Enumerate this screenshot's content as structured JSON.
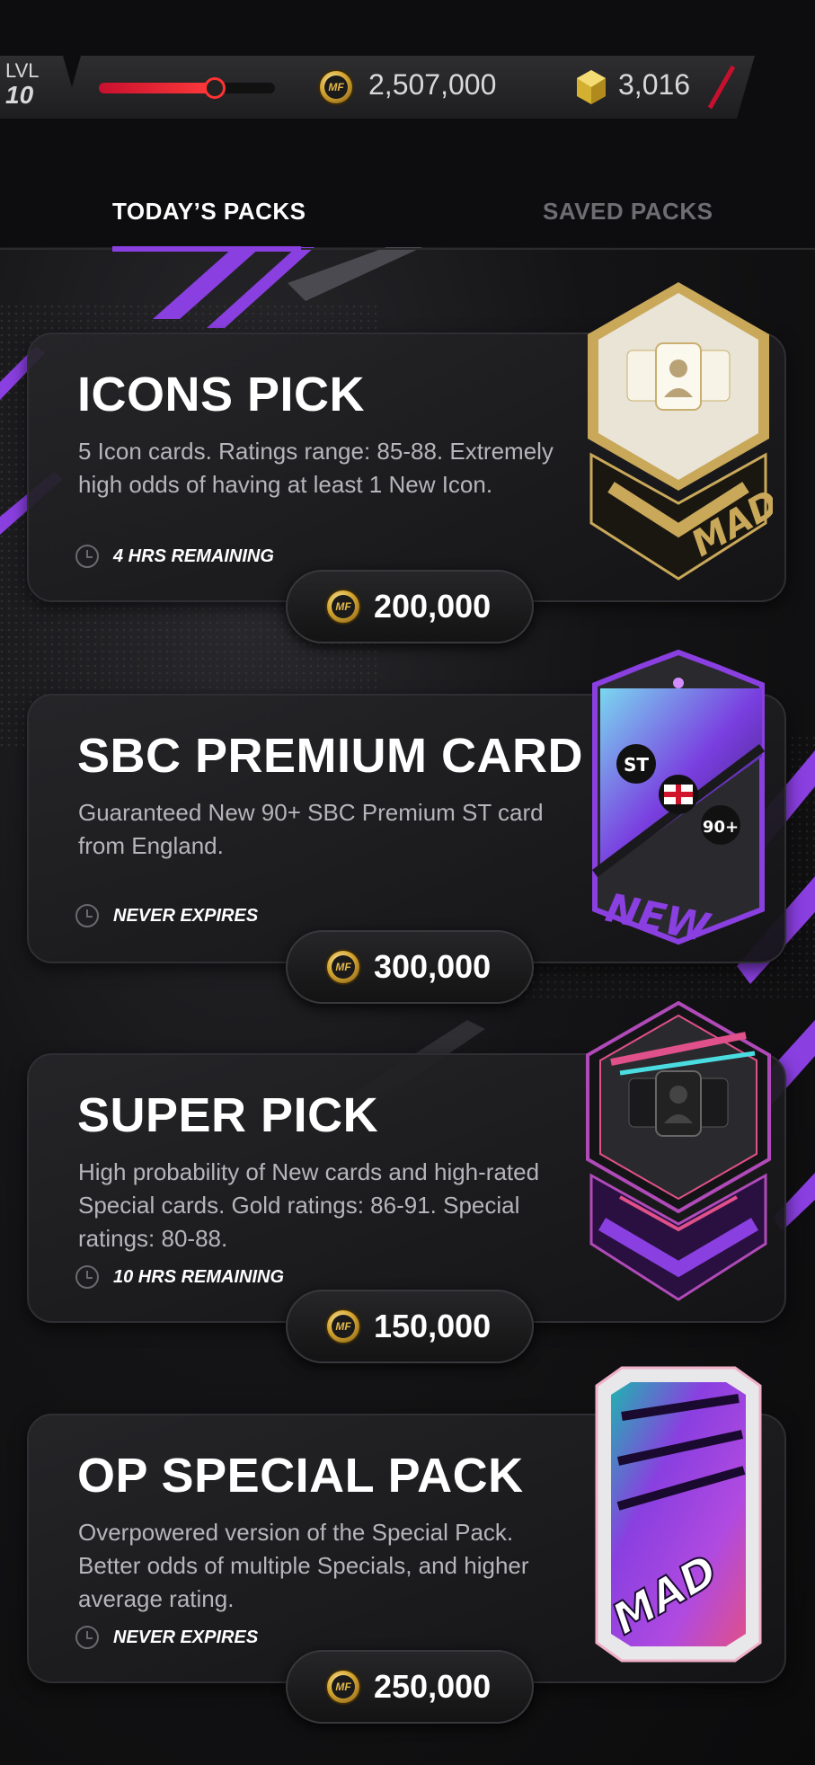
{
  "hud": {
    "level_label": "LVL",
    "level_value": "10",
    "xp_progress": 0.66,
    "coins": "2,507,000",
    "gems": "3,016",
    "coin_icon_text": "MF"
  },
  "tabs": [
    {
      "label": "TODAY’S PACKS",
      "active": true
    },
    {
      "label": "SAVED PACKS",
      "active": false
    }
  ],
  "packs": [
    {
      "title": "ICONS PICK",
      "description": "5 Icon cards. Ratings range: 85-88. Extremely high odds of having at least 1 New Icon.",
      "timer": "4 HRS REMAINING",
      "price": "200,000",
      "art": "icons-pick-pack-icon"
    },
    {
      "title": "SBC PREMIUM CARD",
      "description": "Guaranteed New 90+ SBC Premium ST card from England.",
      "timer": "NEVER EXPIRES",
      "price": "300,000",
      "art": "sbc-premium-card-icon",
      "badge_position": "ST",
      "badge_rating": "90+",
      "badge_new": "NEW"
    },
    {
      "title": "SUPER PICK",
      "description": "High probability of New cards and high-rated Special cards. Gold ratings: 86-91. Special ratings: 80-88.",
      "timer": "10 HRS REMAINING",
      "price": "150,000",
      "art": "super-pick-pack-icon"
    },
    {
      "title": "OP SPECIAL PACK",
      "description": "Overpowered version of the Special Pack. Better odds of multiple Specials, and higher average rating.",
      "timer": "NEVER EXPIRES",
      "price": "250,000",
      "art": "op-special-pack-icon"
    }
  ],
  "colors": {
    "accent": "#8a3fe0",
    "xp_red": "#e3222f",
    "coin_gold": "#d6a632",
    "background": "#0d0d0f"
  }
}
